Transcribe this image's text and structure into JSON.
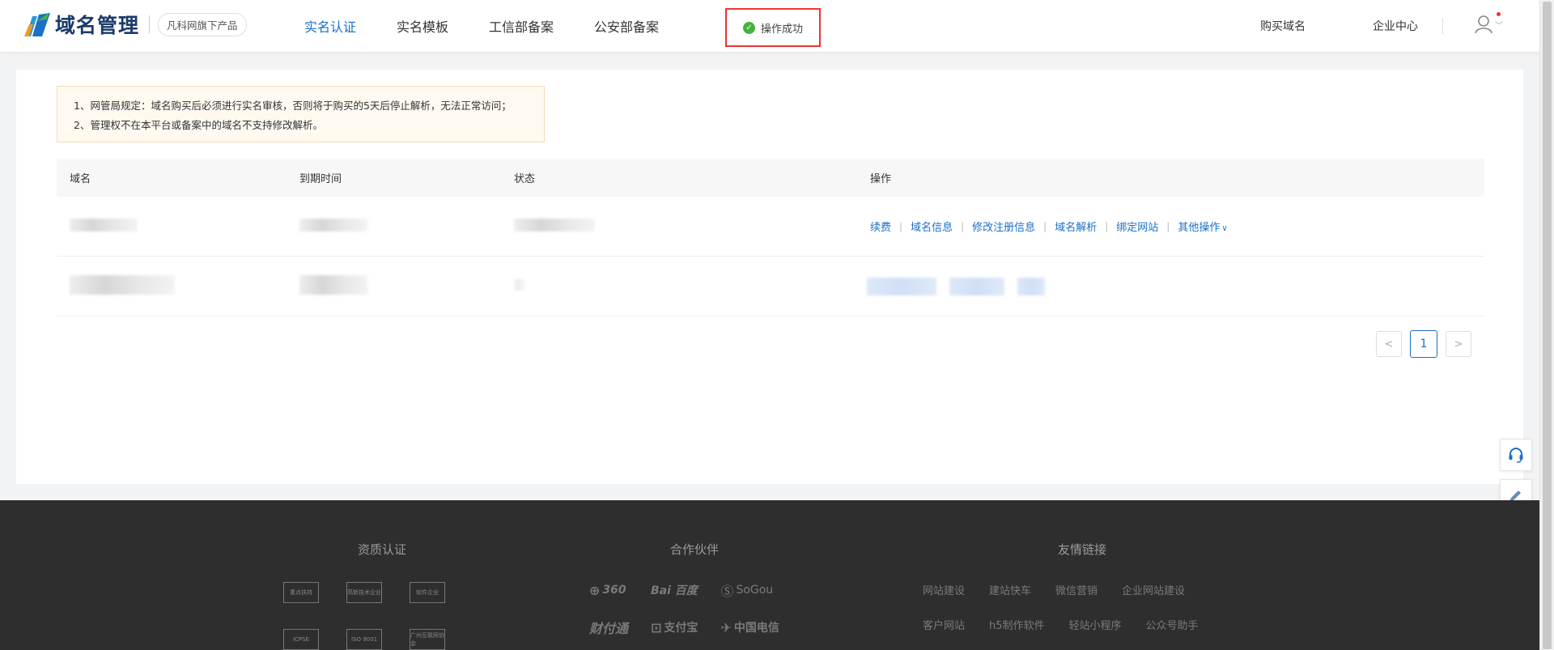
{
  "header": {
    "logo_text": "域名管理",
    "product_badge": "凡科网旗下产品",
    "nav": [
      "实名认证",
      "实名模板",
      "工信部备案",
      "公安部备案"
    ],
    "active_nav": 0,
    "toast": "操作成功",
    "buy_domain": "购买域名",
    "enterprise_center": "企业中心"
  },
  "notice": {
    "line1": "1、网管局规定：域名购买后必须进行实名审核，否则将于购买的5天后停止解析，无法正常访问；",
    "line2": "2、管理权不在本平台或备案中的域名不支持修改解析。"
  },
  "table": {
    "columns": [
      "域名",
      "到期时间",
      "状态",
      "操作"
    ],
    "row1_ops": [
      "续费",
      "域名信息",
      "修改注册信息",
      "域名解析",
      "绑定网站",
      "其他操作"
    ]
  },
  "pagination": {
    "current": "1",
    "prev": "<",
    "next": ">"
  },
  "footer": {
    "col1_title": "资质认证",
    "col2_title": "合作伙伴",
    "col3_title": "友情链接",
    "certs": [
      "重点扶持",
      "高新技术企业",
      "软件企业",
      "ICPSE",
      "ISO 9001",
      "广州互联网协会"
    ],
    "partners": [
      "360",
      "Bai 百度",
      "SoGou",
      "财付通",
      "支付宝",
      "中国电信"
    ],
    "links": [
      "网站建设",
      "建站快车",
      "微信营销",
      "企业网站建设",
      "客户网站",
      "h5制作软件",
      "轻站小程序",
      "公众号助手"
    ]
  },
  "colors": {
    "accent": "#1a6fc9",
    "toast_border": "#e33333",
    "success": "#47b13d",
    "footer_bg": "#2e2e2e"
  }
}
